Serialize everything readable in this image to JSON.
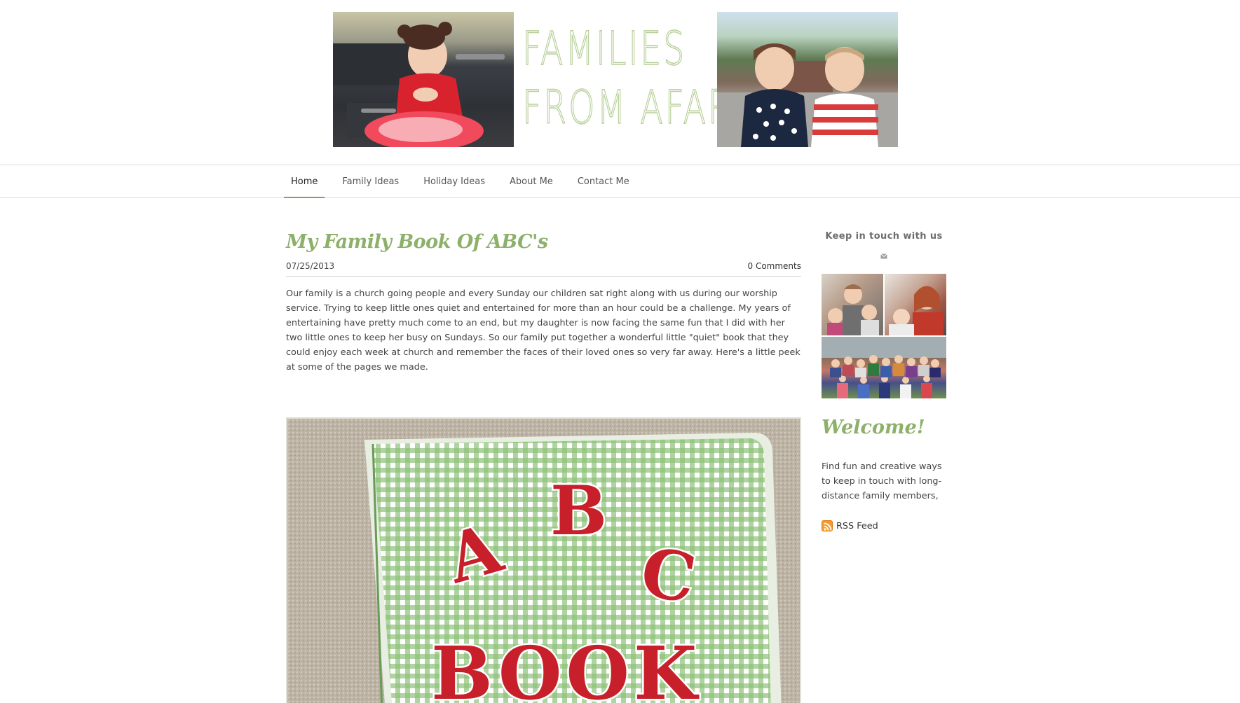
{
  "site": {
    "title_line_1": "FAMILIES",
    "title_line_2": "FROM AFAR"
  },
  "nav": {
    "items": [
      {
        "label": "Home",
        "active": true
      },
      {
        "label": "Family Ideas"
      },
      {
        "label": "Holiday Ideas"
      },
      {
        "label": "About Me"
      },
      {
        "label": "Contact Me"
      }
    ]
  },
  "post": {
    "title": "My Family Book Of ABC's",
    "date": "07/25/2013",
    "comments": "0 Comments",
    "body": "Our family is a church going people and every Sunday our children sat right along with us during our worship service.  Trying to keep little ones quiet and entertained for more than an hour could be a challenge.   My years of entertaining have pretty much come to an end, but my daughter is now facing the same fun that I did with her two little ones to keep her busy on Sundays. So our family put together a wonderful little \"quiet\" book that they could enjoy each week at church and remember the faces of their loved ones so very far away.   Here's a little peek at some of the pages we made.",
    "image_text": {
      "letter_a": "A",
      "letter_b": "B",
      "letter_c": "C",
      "word_book": "BOOK"
    }
  },
  "sidebar": {
    "keep_in_touch": "Keep in touch with us",
    "mail_icon": "envelope-icon",
    "welcome_title": "Welcome!",
    "welcome_text": "Find fun and creative ways to keep in touch with long-distance family members,",
    "rss_label": "RSS Feed",
    "rss_icon": "rss-icon"
  },
  "colors": {
    "accent_green": "#8db06a",
    "nav_active_underline": "#7fa35a",
    "rss_orange": "#f39c2c",
    "letter_red": "#c8202a"
  }
}
